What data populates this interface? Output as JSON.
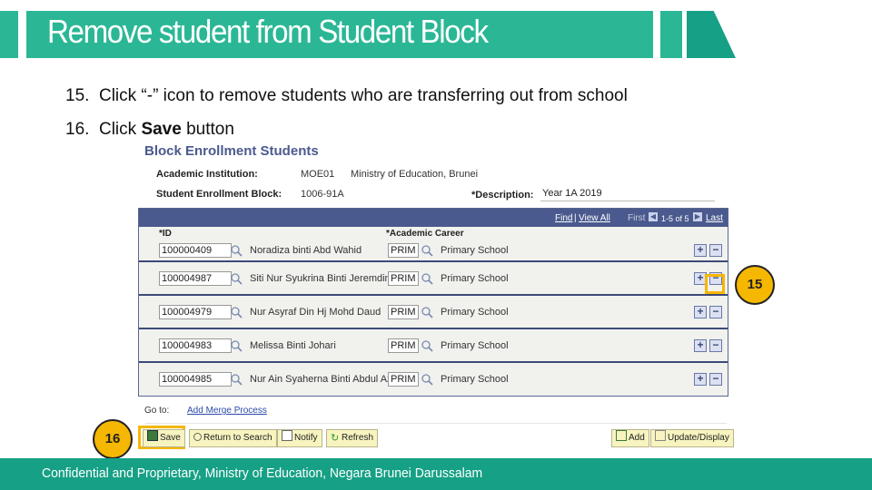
{
  "slide": {
    "title": "Remove student from Student Block",
    "steps": [
      {
        "number": "15.",
        "text": "Click “-” icon to remove students who are transferring out from school"
      },
      {
        "number": "16.",
        "text_before": "Click ",
        "bold": "Save",
        "text_after": " button"
      }
    ],
    "badges": {
      "step15": "15",
      "step16": "16"
    },
    "footer": "Confidential and Proprietary, Ministry of Education, Negara Brunei Darussalam",
    "accent_color": "#2bb795",
    "highlight_color": "#f5b700"
  },
  "panel": {
    "title": "Block Enrollment Students",
    "academic_institution_label": "Academic Institution:",
    "academic_institution_code": "MOE01",
    "academic_institution_name": "Ministry of Education, Brunei",
    "enrollment_block_label": "Student Enrollment Block:",
    "enrollment_block_value": "1006-91A",
    "description_label": "*Description:",
    "description_value": "Year 1A 2019"
  },
  "grid": {
    "find": "Find",
    "separator": "|",
    "view_all": "View All",
    "first": "First",
    "range": "1-5 of 5",
    "last": "Last",
    "col_id": "*ID",
    "col_career": "*Academic Career",
    "rows": [
      {
        "id": "100000409",
        "name": "Noradiza binti Abd Wahid",
        "career": "PRIM",
        "career_desc": "Primary School"
      },
      {
        "id": "100004987",
        "name": "Siti Nur Syukrina Binti Jeremdin",
        "career": "PRIM",
        "career_desc": "Primary School"
      },
      {
        "id": "100004979",
        "name": "Nur Asyraf Din Hj Mohd Daud",
        "career": "PRIM",
        "career_desc": "Primary School"
      },
      {
        "id": "100004983",
        "name": "Melissa Binti Johari",
        "career": "PRIM",
        "career_desc": "Primary School"
      },
      {
        "id": "100004985",
        "name": "Nur Ain Syaherna Binti Abdul Aziz",
        "career": "PRIM",
        "career_desc": "Primary School"
      }
    ],
    "add_row_symbol": "+",
    "delete_row_symbol": "−"
  },
  "goto": {
    "label": "Go to:",
    "link": "Add Merge Process"
  },
  "toolbar": {
    "save": "Save",
    "return_to_search": "Return to Search",
    "notify": "Notify",
    "refresh": "Refresh",
    "add": "Add",
    "update_display": "Update/Display"
  }
}
